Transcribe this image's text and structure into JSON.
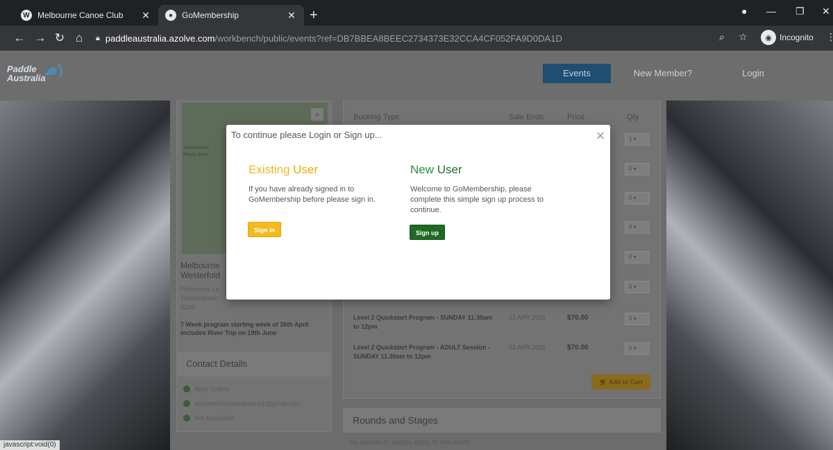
{
  "browser": {
    "tabs": [
      {
        "title": "Melbourne Canoe Club",
        "icon": "wordpress-icon"
      },
      {
        "title": "GoMembership",
        "icon": "globe-icon"
      }
    ],
    "url_host": "paddleaustralia.azolve.com",
    "url_path": "/workbench/public/events?ref=DB7BBEA8BEEC2734373E32CCA4CF052FA9D0DA1D",
    "incognito_label": "Incognito"
  },
  "site": {
    "logo_line1": "Paddle",
    "logo_line2": "Australia",
    "nav": {
      "events": "Events",
      "new_member": "New Member?",
      "login": "Login"
    }
  },
  "venue": {
    "title_line1": "Melbourne",
    "title_line2": "Westerfold",
    "addr_line1": "Fitzsimons La",
    "addr_line2": "Templestowe",
    "addr_line3": "3106",
    "program_note": "7 Week program starting week of 26th April includes River Trip on 19th June",
    "map_label1": "Westerfolds",
    "map_label2": "Picnic Area"
  },
  "contact": {
    "heading": "Contact Details",
    "name": "Abby Collins",
    "email": "abbymelbournecanoeclub@gmail.com",
    "phone": "Not Applicable"
  },
  "booking": {
    "headers": {
      "type": "Booking Type",
      "sale_ends": "Sale Ends",
      "price": "Price",
      "qty": "Qty"
    },
    "qty_values": [
      "1",
      "0",
      "0",
      "0",
      "0",
      "0",
      "0",
      "0"
    ],
    "rows": [
      {
        "type": "Level 2 Quickstart Program - SUNDAY 11:30am to 12pm",
        "date": "22 APR 2021",
        "price": "$70.00"
      },
      {
        "type": "Level 2 Quickstart Program - ADULT Session - SUNDAY 11.30am to 12pm",
        "date": "22 APR 2021",
        "price": "$70.00"
      }
    ],
    "add_to_cart": "Add to Cart"
  },
  "rounds": {
    "heading": "Rounds and Stages",
    "text": "No rounds or stages apply to this event"
  },
  "status_bar": "javascript:void(0)",
  "modal": {
    "title": "To continue please Login or Sign up...",
    "existing": {
      "heading_a": "Existing",
      "heading_b": "User",
      "text": "If you have already signed in to GoMembership before please sign in.",
      "button": "Sign in"
    },
    "new": {
      "heading_a": "New",
      "heading_b": "User",
      "text": "Welcome to GoMembership, please complete this simple sign up process to continue.",
      "button": "Sign up"
    }
  },
  "colors": {
    "existing_accent": "#f5b91c",
    "new_accent": "#1e6a24",
    "events_nav": "#1f4e73"
  }
}
